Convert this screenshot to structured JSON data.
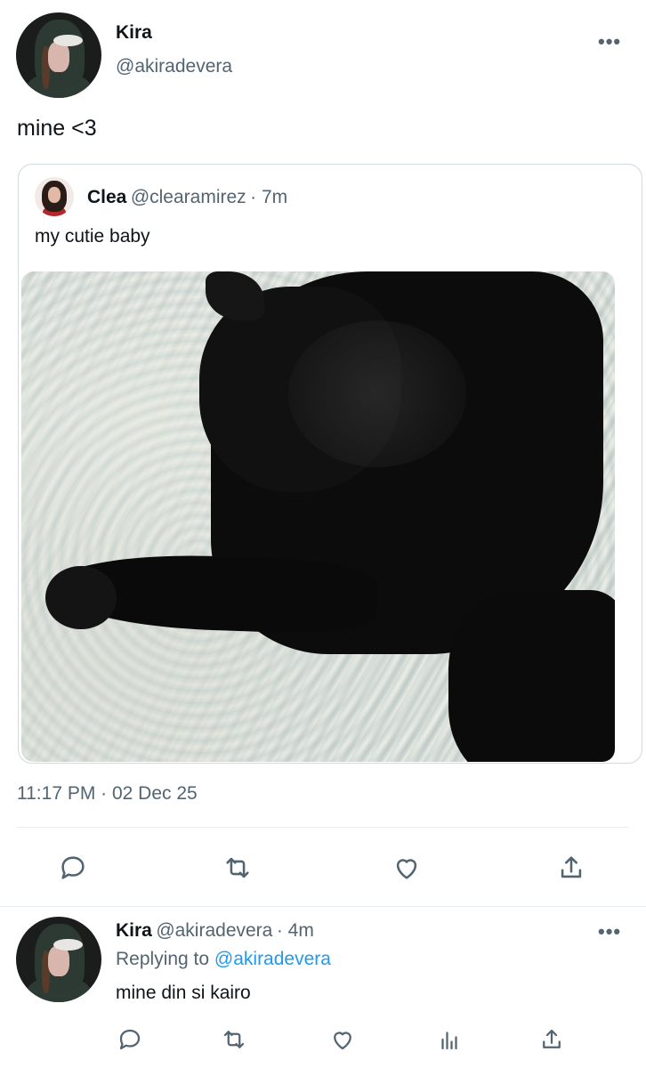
{
  "main_tweet": {
    "author_name": "Kira",
    "author_handle": "@akiradevera",
    "text": "mine <3",
    "more_label": "•••",
    "timestamp": "11:17 PM · 02 Dec 25",
    "quote": {
      "author_name": "Clea",
      "author_handle": "@clearamirez",
      "time_ago": "· 7m",
      "text": "my cutie baby",
      "image_description_icon": "photo-black-cat"
    },
    "actions": [
      "reply-icon",
      "retweet-icon",
      "like-icon",
      "share-icon"
    ]
  },
  "reply_tweet": {
    "author_name": "Kira",
    "author_handle": "@akiradevera",
    "time_ago": "· 4m",
    "more_label": "•••",
    "replying_prefix": "Replying to",
    "replying_to": "@akiradevera",
    "text": "mine din si kairo",
    "actions": [
      "reply-icon",
      "retweet-icon",
      "like-icon",
      "analytics-icon",
      "share-icon"
    ]
  },
  "colors": {
    "text_primary": "#0f1419",
    "text_secondary": "#536471",
    "link": "#1d9bf0",
    "border": "#cfd9de"
  }
}
